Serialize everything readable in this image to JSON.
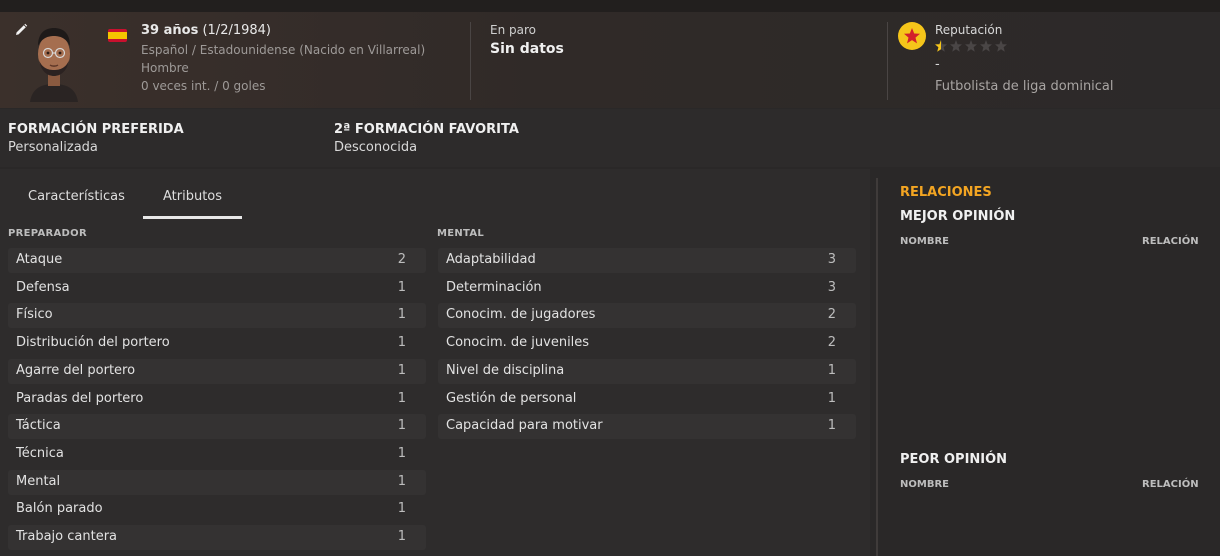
{
  "profile": {
    "age_bold": "39 años",
    "birth_date": "(1/2/1984)",
    "nationality": "Español / Estadounidense (Nacido en Villarreal)",
    "gender": "Hombre",
    "caps": "0 veces int. / 0 goles",
    "status_label": "En paro",
    "status_value": "Sin datos",
    "reputation_label": "Reputación",
    "reputation_stars": 0.5,
    "reputation_max": 5,
    "reputation_dash": "-",
    "reputation_desc": "Futbolista de liga dominical"
  },
  "formation": {
    "preferred_title": "FORMACIÓN PREFERIDA",
    "preferred_value": "Personalizada",
    "second_title": "2ª FORMACIÓN FAVORITA",
    "second_value": "Desconocida"
  },
  "tabs": [
    {
      "label": "Características",
      "active": false
    },
    {
      "label": "Atributos",
      "active": true
    }
  ],
  "attributes": {
    "coach_title": "PREPARADOR",
    "coach": [
      {
        "name": "Ataque",
        "value": "2"
      },
      {
        "name": "Defensa",
        "value": "1"
      },
      {
        "name": "Físico",
        "value": "1"
      },
      {
        "name": "Distribución del portero",
        "value": "1"
      },
      {
        "name": "Agarre del portero",
        "value": "1"
      },
      {
        "name": "Paradas del portero",
        "value": "1"
      },
      {
        "name": "Táctica",
        "value": "1"
      },
      {
        "name": "Técnica",
        "value": "1"
      },
      {
        "name": "Mental",
        "value": "1"
      },
      {
        "name": "Balón parado",
        "value": "1"
      },
      {
        "name": "Trabajo cantera",
        "value": "1"
      }
    ],
    "mental_title": "MENTAL",
    "mental": [
      {
        "name": "Adaptabilidad",
        "value": "3"
      },
      {
        "name": "Determinación",
        "value": "3"
      },
      {
        "name": "Conocim. de jugadores",
        "value": "2"
      },
      {
        "name": "Conocim. de juveniles",
        "value": "2"
      },
      {
        "name": "Nivel de disciplina",
        "value": "1"
      },
      {
        "name": "Gestión de personal",
        "value": "1"
      },
      {
        "name": "Capacidad para motivar",
        "value": "1"
      }
    ]
  },
  "relations": {
    "title": "RELACIONES",
    "best_title": "MEJOR OPINIÓN",
    "worst_title": "PEOR OPINIÓN",
    "col_name": "NOMBRE",
    "col_relation": "RELACIÓN"
  },
  "colors": {
    "accent_orange": "#f3a522",
    "reputation_gold": "#f5c51a",
    "star_red": "#d3202a"
  }
}
